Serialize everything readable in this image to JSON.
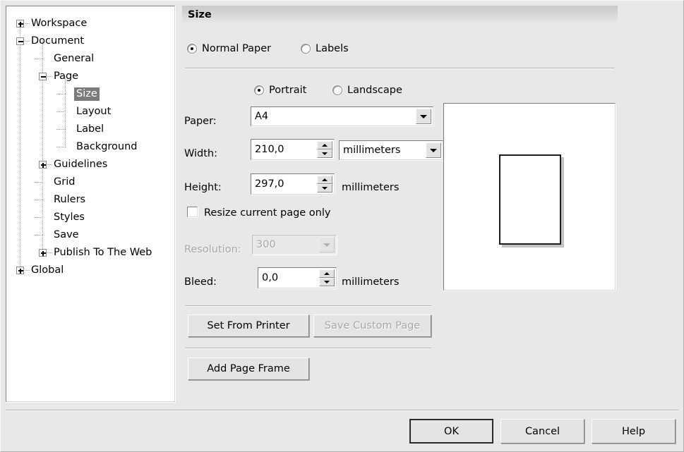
{
  "dialog": {
    "section_title": "Size"
  },
  "tree": {
    "items": [
      {
        "label": "Workspace",
        "depth": 0,
        "expander": "plus",
        "selected": false
      },
      {
        "label": "Document",
        "depth": 0,
        "expander": "minus",
        "selected": false
      },
      {
        "label": "General",
        "depth": 1,
        "expander": "none",
        "selected": false
      },
      {
        "label": "Page",
        "depth": 1,
        "expander": "minus",
        "selected": false
      },
      {
        "label": "Size",
        "depth": 2,
        "expander": "none",
        "selected": true
      },
      {
        "label": "Layout",
        "depth": 2,
        "expander": "none",
        "selected": false
      },
      {
        "label": "Label",
        "depth": 2,
        "expander": "none",
        "selected": false
      },
      {
        "label": "Background",
        "depth": 2,
        "expander": "none",
        "selected": false
      },
      {
        "label": "Guidelines",
        "depth": 1,
        "expander": "plus",
        "selected": false
      },
      {
        "label": "Grid",
        "depth": 1,
        "expander": "none",
        "selected": false
      },
      {
        "label": "Rulers",
        "depth": 1,
        "expander": "none",
        "selected": false
      },
      {
        "label": "Styles",
        "depth": 1,
        "expander": "none",
        "selected": false
      },
      {
        "label": "Save",
        "depth": 1,
        "expander": "none",
        "selected": false
      },
      {
        "label": "Publish To The Web",
        "depth": 1,
        "expander": "plus",
        "selected": false
      },
      {
        "label": "Global",
        "depth": 0,
        "expander": "plus",
        "selected": false
      }
    ]
  },
  "paper_type": {
    "normal_paper_label": "Normal Paper",
    "normal_paper_selected": true,
    "labels_label": "Labels",
    "labels_selected": false
  },
  "orientation": {
    "portrait_label": "Portrait",
    "portrait_selected": true,
    "landscape_label": "Landscape",
    "landscape_selected": false
  },
  "paper": {
    "label": "Paper:",
    "value": "A4"
  },
  "width": {
    "label": "Width:",
    "value": "210,0",
    "units_value": "millimeters"
  },
  "height": {
    "label": "Height:",
    "value": "297,0",
    "units_label": "millimeters"
  },
  "resize_current_page": {
    "label": "Resize current page only",
    "checked": false
  },
  "resolution": {
    "label": "Resolution:",
    "value": "300",
    "disabled": true
  },
  "bleed": {
    "label": "Bleed:",
    "value": "0,0",
    "units_label": "millimeters"
  },
  "actions": {
    "set_from_printer": "Set From Printer",
    "save_custom_page": "Save Custom Page",
    "save_custom_page_disabled": true,
    "add_page_frame": "Add Page Frame"
  },
  "footer": {
    "ok": "OK",
    "cancel": "Cancel",
    "help": "Help"
  }
}
